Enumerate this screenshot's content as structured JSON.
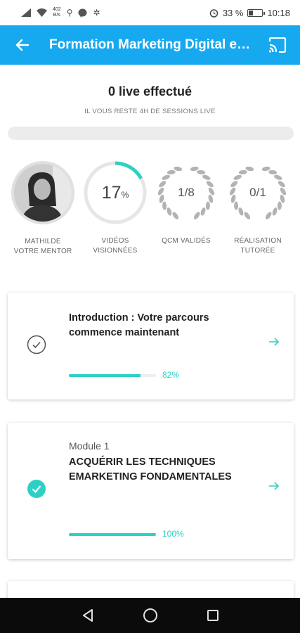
{
  "status_bar": {
    "net_speed": "402",
    "net_unit": "B/s",
    "battery": "33 %",
    "battery_level": 0.33,
    "time": "10:18"
  },
  "app_bar": {
    "title": "Formation Marketing Digital e…",
    "back_icon": "arrow-left-icon",
    "cast_icon": "cast-icon",
    "color": "#16a9f0"
  },
  "live": {
    "title": "0 live effectué",
    "subtitle": "IL VOUS RESTE 4H DE SESSIONS LIVE",
    "progress": 0
  },
  "stats": {
    "mentor": {
      "line1": "MATHILDE",
      "line2": "VOTRE MENTOR"
    },
    "videos": {
      "value": "17",
      "unit": "%",
      "progress": 0.17,
      "line1": "VIDÉOS",
      "line2": "VISIONNÉES"
    },
    "qcm": {
      "value": "1/8",
      "line1": "QCM VALIDÉS",
      "line2": ""
    },
    "realisation": {
      "value": "0/1",
      "line1": "RÉALISATION",
      "line2": "TUTORÉE"
    }
  },
  "modules": [
    {
      "module_label": "",
      "title": "Introduction : Votre parcours commence maintenant",
      "status": "in-progress",
      "progress": 0.82,
      "percent": "82%"
    },
    {
      "module_label": "Module 1",
      "title": "ACQUÉRIR LES TECHNIQUES EMARKETING FONDAMENTALES",
      "status": "completed",
      "progress": 1.0,
      "percent": "100%"
    }
  ],
  "colors": {
    "accent": "#2ed0c5",
    "primary": "#16a9f0"
  },
  "nav": {
    "back": "nav-back-icon",
    "home": "nav-home-icon",
    "recents": "nav-recents-icon"
  }
}
